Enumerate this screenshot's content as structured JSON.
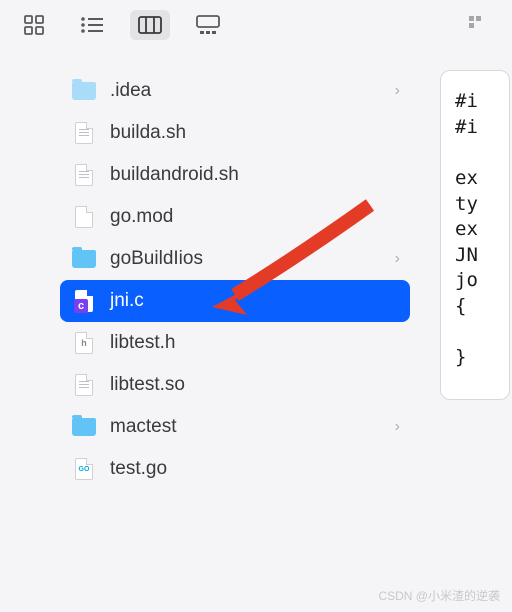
{
  "toolbar": {
    "items": [
      "icon-view",
      "list-view",
      "column-view",
      "gallery-view",
      "group-view"
    ],
    "active": "column-view"
  },
  "files": [
    {
      "name": ".idea",
      "type": "folder-light",
      "hasChevron": true
    },
    {
      "name": "builda.sh",
      "type": "doc"
    },
    {
      "name": "buildandroid.sh",
      "type": "doc"
    },
    {
      "name": "go.mod",
      "type": "doc-blank"
    },
    {
      "name": "goBuildIios",
      "type": "folder",
      "hasChevron": true
    },
    {
      "name": "jni.c",
      "type": "doc-c",
      "selected": true
    },
    {
      "name": "libtest.h",
      "type": "doc-h"
    },
    {
      "name": "libtest.so",
      "type": "doc"
    },
    {
      "name": "mactest",
      "type": "folder",
      "hasChevron": true
    },
    {
      "name": "test.go",
      "type": "doc-go"
    }
  ],
  "code_lines": [
    "#i",
    "#i",
    "",
    "ex",
    "ty",
    "ex",
    "JN",
    "jo",
    "{",
    "",
    "}"
  ],
  "watermark": "CSDN @小米渣的逆袭",
  "arrow_color": "#e43b27"
}
